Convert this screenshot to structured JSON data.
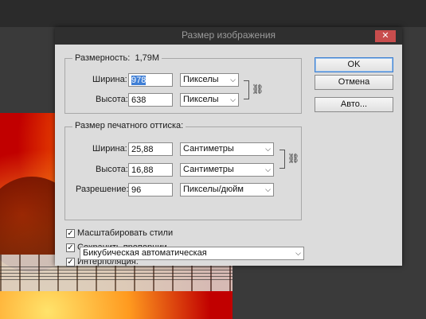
{
  "dialog": {
    "title": "Размер изображения",
    "close_icon": "close-icon"
  },
  "pixel_dimensions": {
    "label": "Размерность:",
    "size": "1,79M",
    "width_label": "Ширина:",
    "width_value": "978",
    "width_unit": "Пикселы",
    "height_label": "Высота:",
    "height_value": "638",
    "height_unit": "Пикселы"
  },
  "document_size": {
    "label": "Размер печатного оттиска:",
    "width_label": "Ширина:",
    "width_value": "25,88",
    "width_unit": "Сантиметры",
    "height_label": "Высота:",
    "height_value": "16,88",
    "height_unit": "Сантиметры",
    "resolution_label": "Разрешение:",
    "resolution_value": "96",
    "resolution_unit": "Пикселы/дюйм"
  },
  "options": {
    "scale_styles": "Масштабировать стили",
    "constrain_proportions": "Сохранить пропорции",
    "resample": "Интерполяция:",
    "resample_method": "Бикубическая автоматическая"
  },
  "buttons": {
    "ok": "OK",
    "cancel": "Отмена",
    "auto": "Авто..."
  },
  "colors": {
    "accent": "#3f7fd6",
    "close": "#c84d4d"
  }
}
